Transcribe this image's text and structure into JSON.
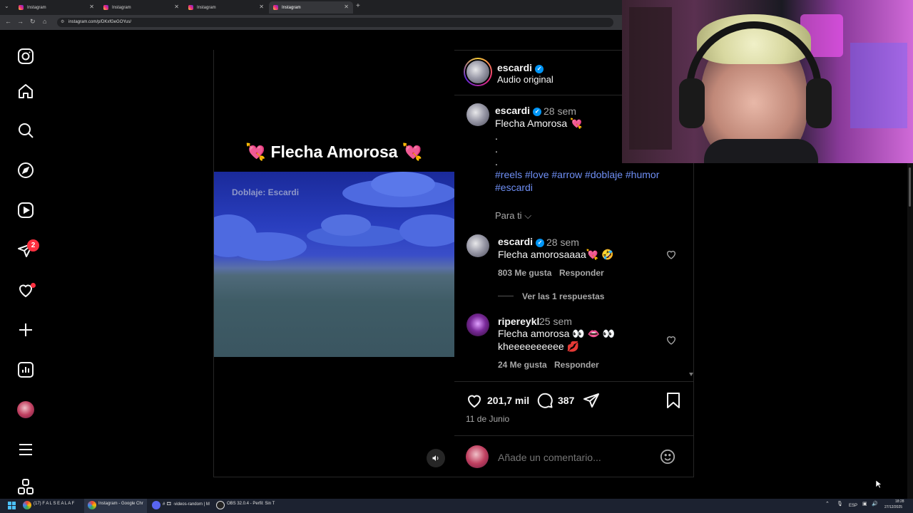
{
  "browser": {
    "tabs": [
      {
        "title": "Instagram",
        "active": false
      },
      {
        "title": "Instagram",
        "active": false
      },
      {
        "title": "Instagram",
        "active": false
      },
      {
        "title": "Instagram",
        "active": true
      }
    ],
    "new_tab": "+",
    "url": "instagram.com/p/DKxfGeGOYus/"
  },
  "sidebar": {
    "items": [
      {
        "icon": "instagram-logo-icon"
      },
      {
        "icon": "home-icon"
      },
      {
        "icon": "search-icon"
      },
      {
        "icon": "explore-icon"
      },
      {
        "icon": "reels-icon"
      },
      {
        "icon": "messages-icon",
        "badge": "2"
      },
      {
        "icon": "notifications-icon"
      },
      {
        "icon": "create-icon"
      },
      {
        "icon": "dashboard-icon"
      },
      {
        "icon": "profile-avatar"
      },
      {
        "icon": "more-menu-icon"
      },
      {
        "icon": "meta-apps-icon"
      }
    ]
  },
  "video": {
    "title": "💘 Flecha Amorosa 💘",
    "caption_overlay": "Doblaje: Escardi"
  },
  "post_header": {
    "username": "escardi",
    "subtitle": "Audio original"
  },
  "caption": {
    "username": "escardi",
    "time": "28 sem",
    "text": "Flecha Amorosa 💘",
    "dots": [
      ".",
      ".",
      "."
    ],
    "hashtags_line1": "#reels #love #arrow #doblaje #humor",
    "hashtags_line2": "#escardi",
    "for_you": "Para ti"
  },
  "comments": [
    {
      "username": "escardi",
      "time": "28 sem",
      "text": "Flecha amorosaaaa💘 🤣",
      "likes": "803 Me gusta",
      "reply": "Responder",
      "view_replies": "Ver las 1 respuestas"
    },
    {
      "username": "ripereykl",
      "time": "25 sem",
      "text": "Flecha amorosa 👀 👄 👀",
      "text2": "kheeeeeeeeee 💋",
      "likes": "24 Me gusta",
      "reply": "Responder"
    }
  ],
  "actions": {
    "likes": "201,7 mil",
    "comments": "387",
    "date": "11 de Junio",
    "comment_placeholder": "Añade un comentario..."
  },
  "taskbar": {
    "items": [
      "(17) F A L S E A L A F",
      "Instagram - Google Chr",
      "# 🎞 ·videos-random | M",
      "OBS 32.0.4 - Perfil: Sin T"
    ],
    "lang": "ESP",
    "time": "18:28",
    "date": "27/12/2025"
  }
}
